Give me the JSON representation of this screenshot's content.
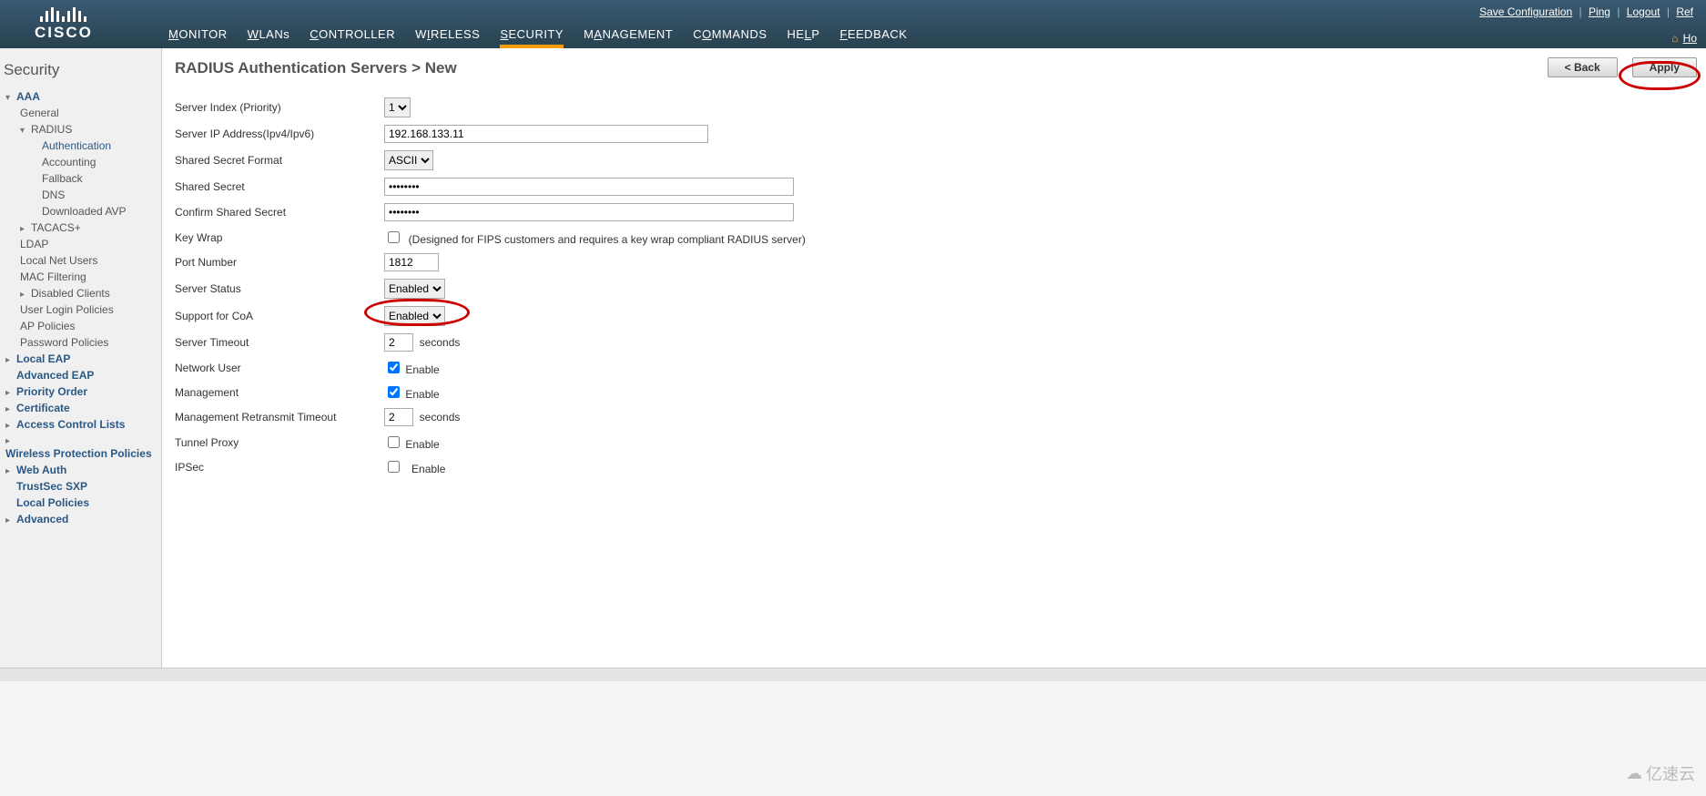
{
  "top_links": {
    "save_config": "Save Configuration",
    "ping": "Ping",
    "logout": "Logout",
    "refresh": "Ref",
    "home": "Ho"
  },
  "brand": "CISCO",
  "nav": {
    "monitor": "MONITOR",
    "wlans": "WLANs",
    "controller": "CONTROLLER",
    "wireless": "WIRELESS",
    "security": "SECURITY",
    "management": "MANAGEMENT",
    "commands": "COMMANDS",
    "help": "HELP",
    "feedback": "FEEDBACK"
  },
  "sidebar": {
    "title": "Security",
    "aaa": "AAA",
    "general": "General",
    "radius": "RADIUS",
    "authentication": "Authentication",
    "accounting": "Accounting",
    "fallback": "Fallback",
    "dns": "DNS",
    "downloaded_avp": "Downloaded AVP",
    "tacacs": "TACACS+",
    "ldap": "LDAP",
    "local_net_users": "Local Net Users",
    "mac_filtering": "MAC Filtering",
    "disabled_clients": "Disabled Clients",
    "user_login_policies": "User Login Policies",
    "ap_policies": "AP Policies",
    "password_policies": "Password Policies",
    "local_eap": "Local EAP",
    "advanced_eap": "Advanced EAP",
    "priority_order": "Priority Order",
    "certificate": "Certificate",
    "acl": "Access Control Lists",
    "wpp": "Wireless Protection Policies",
    "web_auth": "Web Auth",
    "trustsec": "TrustSec SXP",
    "local_policies": "Local Policies",
    "advanced": "Advanced"
  },
  "page": {
    "title": "RADIUS Authentication Servers > New",
    "back": "< Back",
    "apply": "Apply"
  },
  "form": {
    "server_index_label": "Server Index (Priority)",
    "server_index_value": "1",
    "server_ip_label": "Server IP Address(Ipv4/Ipv6)",
    "server_ip_value": "192.168.133.11",
    "secret_format_label": "Shared Secret Format",
    "secret_format_value": "ASCII",
    "shared_secret_label": "Shared Secret",
    "shared_secret_value": "••••••••",
    "confirm_secret_label": "Confirm Shared Secret",
    "confirm_secret_value": "••••••••",
    "key_wrap_label": "Key Wrap",
    "key_wrap_note": "(Designed for FIPS customers and requires a key wrap compliant RADIUS server)",
    "port_label": "Port Number",
    "port_value": "1812",
    "server_status_label": "Server Status",
    "server_status_value": "Enabled",
    "coa_label": "Support for CoA",
    "coa_value": "Enabled",
    "server_timeout_label": "Server Timeout",
    "server_timeout_value": "2",
    "seconds": "seconds",
    "network_user_label": "Network User",
    "enable": "Enable",
    "management_label": "Management",
    "mgmt_retransmit_label": "Management Retransmit Timeout",
    "mgmt_retransmit_value": "2",
    "tunnel_proxy_label": "Tunnel Proxy",
    "ipsec_label": "IPSec"
  },
  "watermark": "亿速云"
}
